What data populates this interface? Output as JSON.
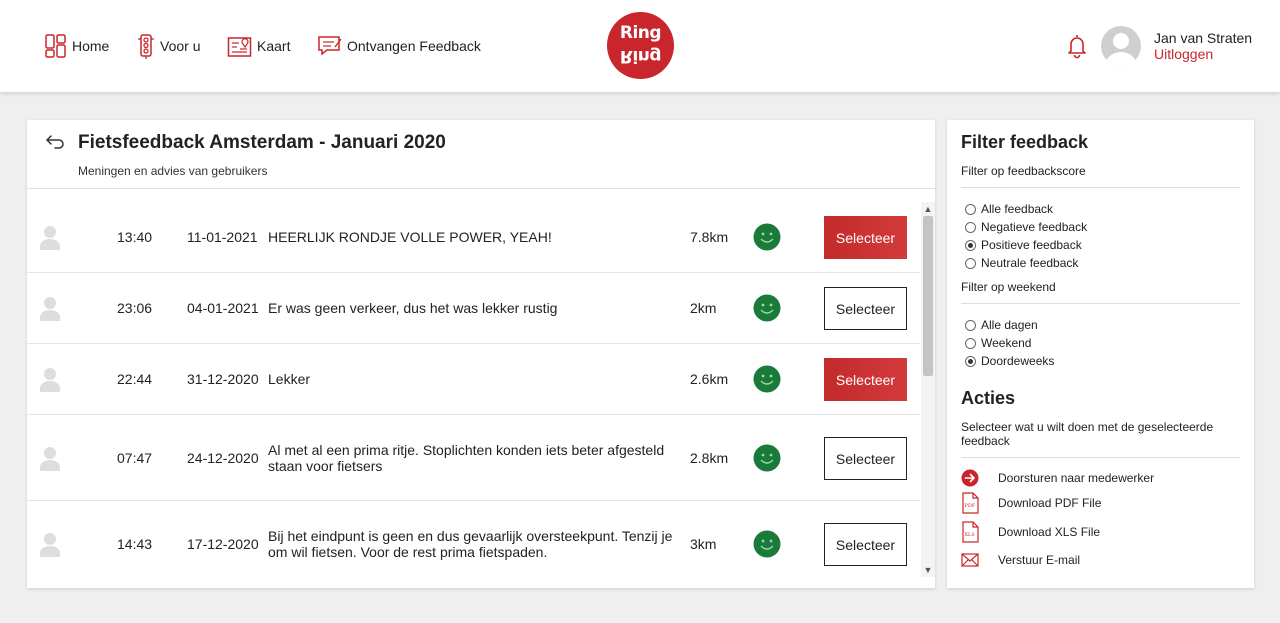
{
  "nav": {
    "home": "Home",
    "for_you": "Voor u",
    "map": "Kaart",
    "received_feedback": "Ontvangen Feedback"
  },
  "logo": {
    "line1": "Ring",
    "line2": "Ring"
  },
  "user": {
    "name": "Jan van Straten",
    "logout": "Uitloggen"
  },
  "panel": {
    "title": "Fietsfeedback Amsterdam - Januari 2020",
    "subtitle": "Meningen en advies van gebruikers"
  },
  "feedback": [
    {
      "time": "13:40",
      "date": "11-01-2021",
      "message": "HEERLIJK RONDJE VOLLE POWER, YEAH!",
      "distance": "7.8km",
      "sentiment": "positive",
      "button": "Selecteer",
      "selected": true
    },
    {
      "time": "23:06",
      "date": "04-01-2021",
      "message": "Er was geen verkeer, dus het was lekker rustig",
      "distance": "2km",
      "sentiment": "positive",
      "button": "Selecteer",
      "selected": false
    },
    {
      "time": "22:44",
      "date": "31-12-2020",
      "message": "Lekker",
      "distance": "2.6km",
      "sentiment": "positive",
      "button": "Selecteer",
      "selected": true
    },
    {
      "time": "07:47",
      "date": "24-12-2020",
      "message": "Al met al een prima ritje. Stoplichten konden iets beter afgesteld staan voor fietsers",
      "distance": "2.8km",
      "sentiment": "positive",
      "button": "Selecteer",
      "selected": false
    },
    {
      "time": "14:43",
      "date": "17-12-2020",
      "message": "Bij het eindpunt is geen en dus gevaarlijk oversteekpunt. Tenzij je om wil fietsen. Voor de rest prima fietspaden.",
      "distance": "3km",
      "sentiment": "positive",
      "button": "Selecteer",
      "selected": false
    }
  ],
  "filter": {
    "title": "Filter feedback",
    "score_label": "Filter op feedbackscore",
    "score_options": [
      "Alle feedback",
      "Negatieve feedback",
      "Positieve feedback",
      "Neutrale feedback"
    ],
    "score_selected": "Positieve feedback",
    "weekend_label": "Filter op weekend",
    "weekend_options": [
      "Alle dagen",
      "Weekend",
      "Doordeweeks"
    ],
    "weekend_selected": "Doordeweeks"
  },
  "actions": {
    "title": "Acties",
    "description": "Selecteer wat u wilt doen met de geselecteerde feedback",
    "items": [
      "Doorsturen naar medewerker",
      "Download PDF File",
      "Download XLS File",
      "Verstuur E-mail"
    ],
    "pdf_icon_text": "PDF",
    "xls_icon_text": "XLS"
  },
  "colors": {
    "brand_red": "#c8262c",
    "positive_green": "#1a7a3a"
  },
  "icons": {
    "home": "home-icon",
    "for_you": "traffic-light-icon",
    "map": "map-icon",
    "feedback": "feedback-icon",
    "notifications": "bell-icon",
    "back": "back-arrow-icon",
    "user": "person-icon",
    "sentiment": "smiley-icon"
  }
}
